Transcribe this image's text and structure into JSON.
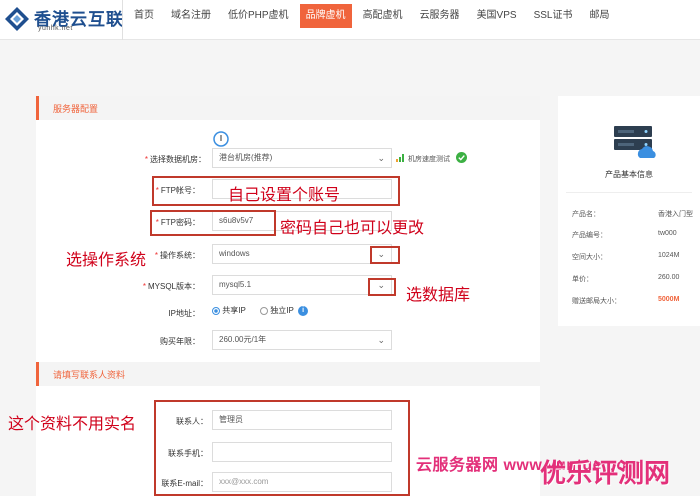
{
  "logo": {
    "name": "香港云互联",
    "sub": "yunhk.net"
  },
  "nav": {
    "items": [
      {
        "label": "首页",
        "active": false
      },
      {
        "label": "域名注册",
        "active": false
      },
      {
        "label": "低价PHP虚机",
        "active": false
      },
      {
        "label": "品牌虚机",
        "active": true
      },
      {
        "label": "高配虚机",
        "active": false
      },
      {
        "label": "云服务器",
        "active": false
      },
      {
        "label": "美国VPS",
        "active": false
      },
      {
        "label": "SSL证书",
        "active": false
      },
      {
        "label": "邮局",
        "active": false
      }
    ]
  },
  "server_config": {
    "section_title": "服务器配置",
    "datacenter": {
      "label": "选择数据机房：",
      "value": "港台机房(推荐)",
      "speed_test": "机房速度测试"
    },
    "ftp_account": {
      "label": "FTP帐号：",
      "value": ""
    },
    "ftp_password": {
      "label": "FTP密码：",
      "value": "s6u8v5v7"
    },
    "os": {
      "label": "操作系统：",
      "value": "windows"
    },
    "mysql": {
      "label": "MYSQL版本：",
      "value": "mysql5.1"
    },
    "ip": {
      "label": "IP地址：",
      "shared": "共享IP",
      "dedicated": "独立IP",
      "info_icon": "i"
    },
    "years": {
      "label": "购买年限：",
      "value": "260.00元/1年"
    }
  },
  "contact": {
    "section_title": "请填写联系人资料",
    "name": {
      "label": "联系人：",
      "value": "管理员"
    },
    "phone": {
      "label": "联系手机：",
      "value": ""
    },
    "email": {
      "label": "联系E-mail：",
      "placeholder": "xxx@xxx.com"
    }
  },
  "product": {
    "title": "产品基本信息",
    "specs": [
      {
        "key": "产品名：",
        "value": "香港入门型",
        "highlight": false
      },
      {
        "key": "产品编号：",
        "value": "tw000",
        "highlight": false
      },
      {
        "key": "空间大小：",
        "value": "1024M",
        "highlight": false
      },
      {
        "key": "单价：",
        "value": "260.00",
        "highlight": false
      },
      {
        "key": "赠送邮局大小：",
        "value": "5000M",
        "highlight": true
      }
    ]
  },
  "annotations": {
    "ftp_account_note": "自己设置个账号",
    "ftp_password_note": "密码自己也可以更改",
    "os_note": "选操作系统",
    "mysql_note": "选数据库",
    "contact_note": "这个资料不用实名"
  },
  "watermarks": {
    "left": "云服务器网 www.yuntue.com",
    "right": "优乐评测网"
  },
  "colors": {
    "accent": "#f0643c",
    "annotation": "#d0021b",
    "ok": "#3cb043",
    "info": "#3b8fe0"
  },
  "icons": [
    "logo-mark-icon",
    "server-icon",
    "signal-bars-icon",
    "check-icon",
    "chevron-down-icon",
    "info-icon",
    "cursor-icon"
  ]
}
